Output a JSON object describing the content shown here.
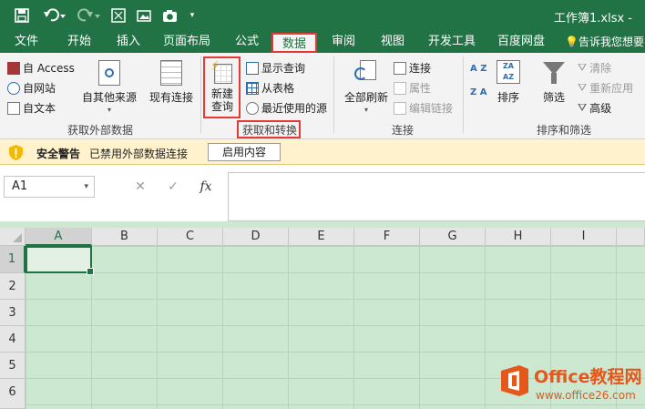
{
  "titlebar": {
    "title": "工作簿1.xlsx -",
    "icons": [
      "save-icon",
      "undo-icon",
      "redo-icon",
      "screenshot-icon",
      "picture-icon",
      "camera-icon",
      "customize-qat-icon"
    ],
    "bg": "#217346"
  },
  "tabs": {
    "items": [
      "文件",
      "开始",
      "插入",
      "页面布局",
      "公式",
      "数据",
      "审阅",
      "视图",
      "开发工具",
      "百度网盘"
    ],
    "active": "数据",
    "tell_me": "告诉我您想要"
  },
  "ribbon": {
    "get_external": {
      "access": "自 Access",
      "web": "自网站",
      "text": "自文本",
      "other_sources": "自其他来源",
      "existing": "现有连接",
      "group_label": "获取外部数据"
    },
    "get_transform": {
      "new_query_line1": "新建",
      "new_query_line2": "查询",
      "show_queries": "显示查询",
      "from_table": "从表格",
      "recent_sources": "最近使用的源",
      "group_label": "获取和转换"
    },
    "connections": {
      "refresh_all": "全部刷新",
      "connections": "连接",
      "properties": "属性",
      "edit_links": "编辑链接",
      "group_label": "连接"
    },
    "sort_filter": {
      "sort_az": "A Z",
      "sort_za": "Z A",
      "sort": "排序",
      "filter": "筛选",
      "clear": "清除",
      "reapply": "重新应用",
      "advanced": "高级",
      "group_label": "排序和筛选"
    }
  },
  "security_bar": {
    "title": "安全警告",
    "message": "已禁用外部数据连接",
    "button": "启用内容"
  },
  "formula_bar": {
    "name_box": "A1",
    "cancel": "✕",
    "enter": "✓",
    "fx": "fx"
  },
  "grid": {
    "columns": [
      "A",
      "B",
      "C",
      "D",
      "E",
      "F",
      "G",
      "H",
      "I"
    ],
    "rows": [
      "1",
      "2",
      "3",
      "4",
      "5",
      "6"
    ],
    "selected_cell": "A1"
  },
  "watermark": {
    "brand": "Office教程网",
    "url": "www.office26.com"
  },
  "colors": {
    "accent": "#217346",
    "highlight": "#e53935",
    "sheet": "#cde8d0"
  }
}
